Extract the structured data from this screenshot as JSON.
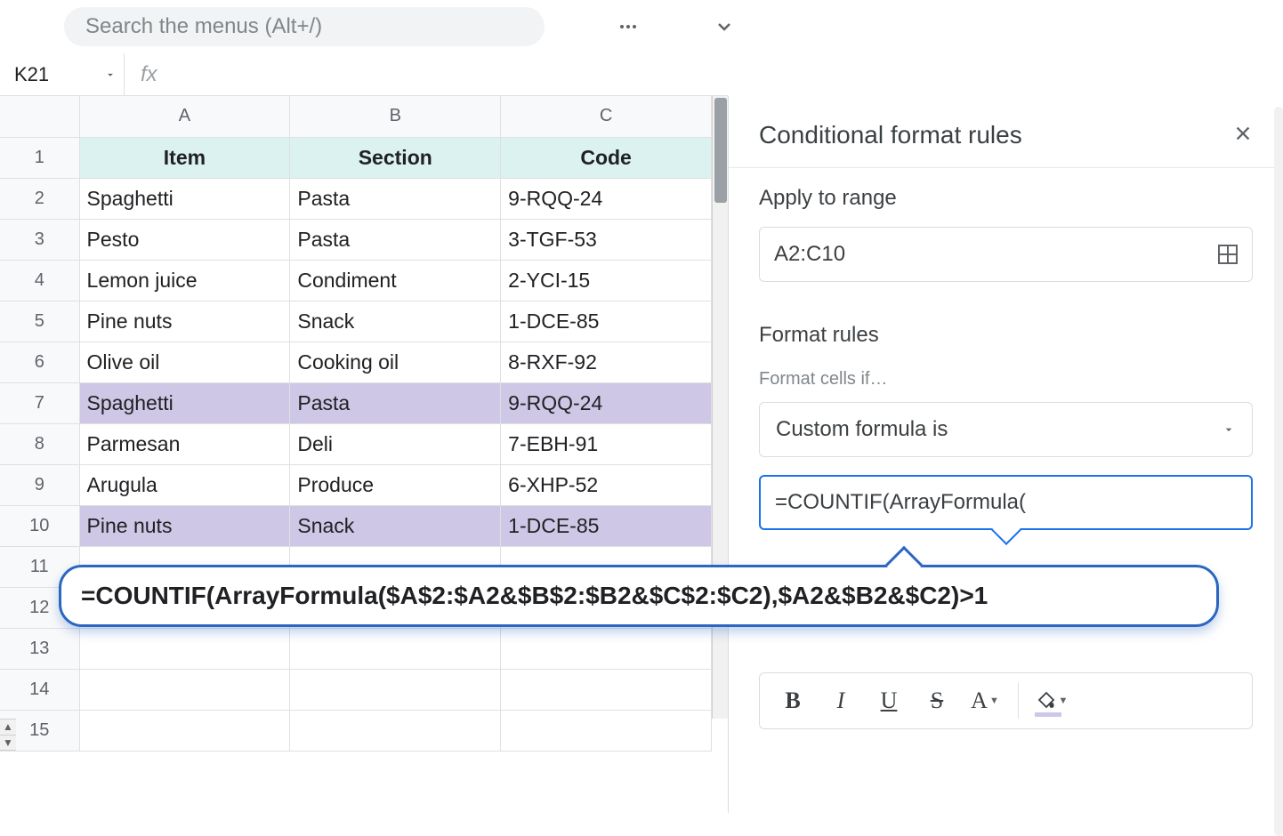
{
  "search": {
    "placeholder": "Search the menus (Alt+/)"
  },
  "namebox": {
    "value": "K21"
  },
  "fx": {
    "label": "fx"
  },
  "columns": [
    "A",
    "B",
    "C"
  ],
  "row_numbers": [
    "1",
    "2",
    "3",
    "4",
    "5",
    "6",
    "7",
    "8",
    "9",
    "10",
    "11",
    "12",
    "13",
    "14",
    "15"
  ],
  "header_row": {
    "item": "Item",
    "section": "Section",
    "code": "Code"
  },
  "rows": [
    {
      "item": "Spaghetti",
      "section": "Pasta",
      "code": "9-RQQ-24",
      "hl": false
    },
    {
      "item": "Pesto",
      "section": "Pasta",
      "code": "3-TGF-53",
      "hl": false
    },
    {
      "item": "Lemon juice",
      "section": "Condiment",
      "code": "2-YCI-15",
      "hl": false
    },
    {
      "item": "Pine nuts",
      "section": "Snack",
      "code": "1-DCE-85",
      "hl": false
    },
    {
      "item": "Olive oil",
      "section": "Cooking oil",
      "code": "8-RXF-92",
      "hl": false
    },
    {
      "item": "Spaghetti",
      "section": "Pasta",
      "code": "9-RQQ-24",
      "hl": true
    },
    {
      "item": "Parmesan",
      "section": "Deli",
      "code": "7-EBH-91",
      "hl": false
    },
    {
      "item": "Arugula",
      "section": "Produce",
      "code": "6-XHP-52",
      "hl": false
    },
    {
      "item": "Pine nuts",
      "section": "Snack",
      "code": "1-DCE-85",
      "hl": true
    }
  ],
  "sidepanel": {
    "title": "Conditional format rules",
    "apply_label": "Apply to range",
    "range": "A2:C10",
    "format_rules_label": "Format rules",
    "cells_if_label": "Format cells if…",
    "condition": "Custom formula is",
    "formula_short": "=COUNTIF(ArrayFormula(",
    "fmt_bold": "B",
    "fmt_italic": "I",
    "fmt_underline": "U",
    "fmt_strike": "S",
    "fmt_textcolor": "A"
  },
  "balloon": {
    "full_formula": "=COUNTIF(ArrayFormula($A$2:$A2&$B$2:$B2&$C$2:$C2),$A2&$B2&$C2)>1"
  }
}
